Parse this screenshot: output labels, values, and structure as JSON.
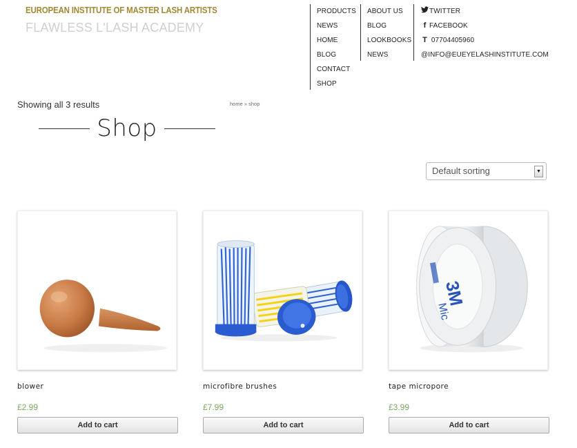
{
  "header": {
    "logo_top": "EUROPEAN INSTITUTE OF MASTER LASH ARTISTS",
    "logo_bottom": "FLAWLESS L'LASH ACADEMY"
  },
  "colors": {
    "logo_gold": "#a28834",
    "price_green": "#7aa85d"
  },
  "nav": {
    "col1": [
      "PRODUCTS",
      "NEWS",
      "HOME",
      "BLOG",
      "CONTACT",
      "SHOP"
    ],
    "col2": [
      "ABOUT US",
      "BLOG",
      "LOOKBOOKS",
      "NEWS"
    ],
    "social": {
      "twitter": "TWITTER",
      "facebook": "FACEBOOK",
      "phone": "07704405960",
      "email": "@INFO@EUEYELASHINSTITUTE.COM",
      "twitter_icon": "twitter-bird-icon",
      "facebook_icon": "facebook-f-icon",
      "phone_icon": "telephone-t-icon"
    }
  },
  "shop": {
    "results_text": "Showing all 3 results",
    "breadcrumb": "home » shop",
    "title": "Shop",
    "sort_selected": "Default sorting"
  },
  "products": [
    {
      "name": "blower",
      "price": "£2.99",
      "button": "Add to cart",
      "image": "rubber-blower"
    },
    {
      "name": "microfibre brushes",
      "price": "£7.99",
      "button": "Add to cart",
      "image": "microbrush-tubes"
    },
    {
      "name": "tape micropore",
      "price": "£3.99",
      "button": "Add to cart",
      "image": "micropore-tape-roll"
    }
  ]
}
